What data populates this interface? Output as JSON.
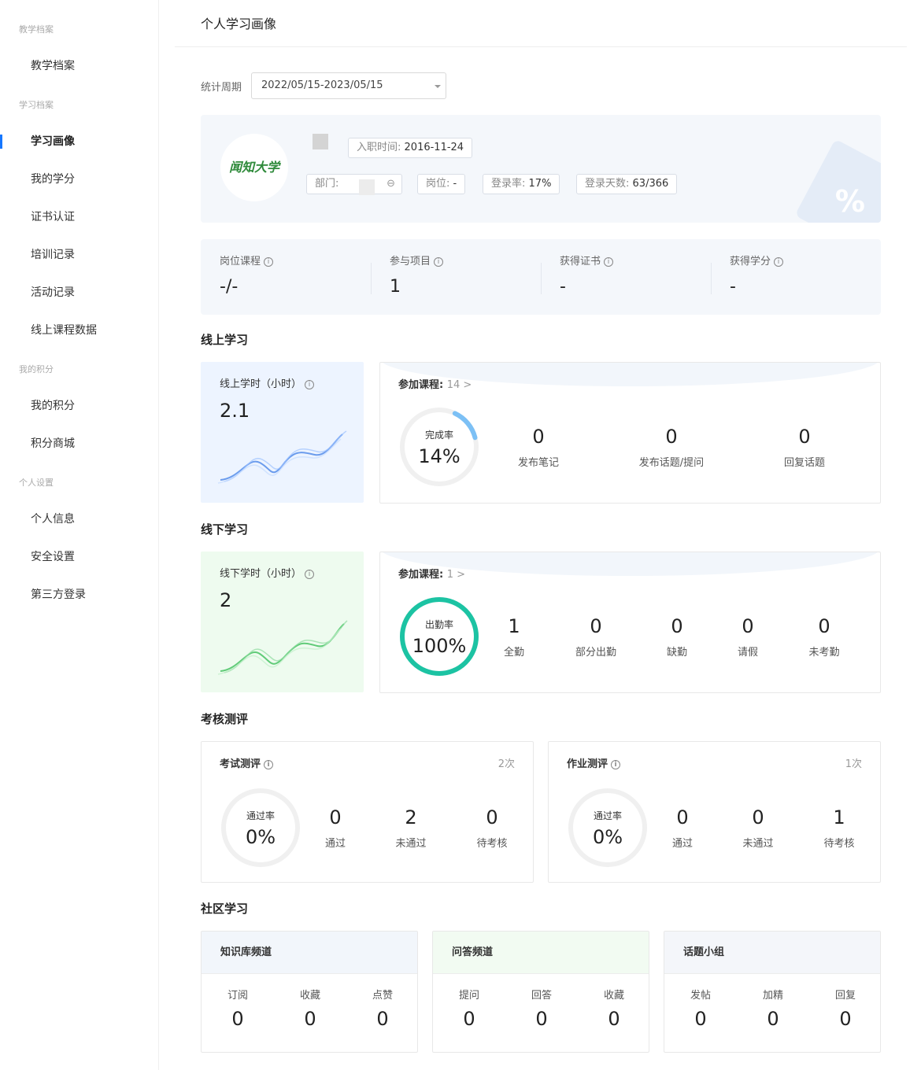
{
  "page": {
    "title": "个人学习画像"
  },
  "sidebar": {
    "groups": [
      "教学档案",
      "学习档案",
      "我的积分",
      "个人设置"
    ],
    "items": [
      "教学档案",
      "学习画像",
      "我的学分",
      "证书认证",
      "培训记录",
      "活动记录",
      "线上课程数据",
      "我的积分",
      "积分商城",
      "个人信息",
      "安全设置",
      "第三方登录"
    ],
    "active": "学习画像"
  },
  "filter": {
    "label": "统计周期",
    "value": "2022/05/15-2023/05/15"
  },
  "profile": {
    "logo_text": "闻知大学",
    "hire_label": "入职时间:",
    "hire_value": "2016-11-24",
    "dept_label": "部门:",
    "position_label": "岗位:",
    "position_value": "-",
    "login_rate_label": "登录率:",
    "login_rate_value": "17%",
    "login_days_label": "登录天数:",
    "login_days_value": "63/366",
    "deco_symbol": "%"
  },
  "stats": [
    {
      "label": "岗位课程",
      "value": "-/-"
    },
    {
      "label": "参与项目",
      "value": "1"
    },
    {
      "label": "获得证书",
      "value": "-"
    },
    {
      "label": "获得学分",
      "value": "-"
    }
  ],
  "online": {
    "section_title": "线上学习",
    "hours_label": "线上学时（小时）",
    "hours_value": "2.1",
    "courses_label": "参加课程:",
    "courses_count": "14 >",
    "ring_label": "完成率",
    "ring_value": "14%",
    "ring_fraction": 0.14,
    "metrics": [
      {
        "value": "0",
        "label": "发布笔记"
      },
      {
        "value": "0",
        "label": "发布话题/提问"
      },
      {
        "value": "0",
        "label": "回复话题"
      }
    ]
  },
  "offline": {
    "section_title": "线下学习",
    "hours_label": "线下学时（小时）",
    "hours_value": "2",
    "courses_label": "参加课程:",
    "courses_count": "1 >",
    "ring_label": "出勤率",
    "ring_value": "100%",
    "ring_fraction": 1.0,
    "metrics": [
      {
        "value": "1",
        "label": "全勤"
      },
      {
        "value": "0",
        "label": "部分出勤"
      },
      {
        "value": "0",
        "label": "缺勤"
      },
      {
        "value": "0",
        "label": "请假"
      },
      {
        "value": "0",
        "label": "未考勤"
      }
    ]
  },
  "evaluation": {
    "section_title": "考核测评",
    "exam": {
      "title": "考试测评",
      "count": "2次",
      "ring_label": "通过率",
      "ring_value": "0%",
      "ring_fraction": 0,
      "metrics": [
        {
          "value": "0",
          "label": "通过"
        },
        {
          "value": "2",
          "label": "未通过"
        },
        {
          "value": "0",
          "label": "待考核"
        }
      ]
    },
    "homework": {
      "title": "作业测评",
      "count": "1次",
      "ring_label": "通过率",
      "ring_value": "0%",
      "ring_fraction": 0,
      "metrics": [
        {
          "value": "0",
          "label": "通过"
        },
        {
          "value": "0",
          "label": "未通过"
        },
        {
          "value": "1",
          "label": "待考核"
        }
      ]
    }
  },
  "community": {
    "section_title": "社区学习",
    "cards": [
      {
        "title": "知识库频道",
        "items": [
          {
            "label": "订阅",
            "value": "0"
          },
          {
            "label": "收藏",
            "value": "0"
          },
          {
            "label": "点赞",
            "value": "0"
          }
        ]
      },
      {
        "title": "问答频道",
        "items": [
          {
            "label": "提问",
            "value": "0"
          },
          {
            "label": "回答",
            "value": "0"
          },
          {
            "label": "收藏",
            "value": "0"
          }
        ]
      },
      {
        "title": "话题小组",
        "items": [
          {
            "label": "发帖",
            "value": "0"
          },
          {
            "label": "加精",
            "value": "0"
          },
          {
            "label": "回复",
            "value": "0"
          }
        ]
      }
    ]
  },
  "colors": {
    "accent": "#1677ff",
    "online_ring": "#7cc0f5",
    "offline_ring": "#1cc3a3",
    "online_card": "#edf4ff",
    "offline_card": "#eefbef"
  }
}
